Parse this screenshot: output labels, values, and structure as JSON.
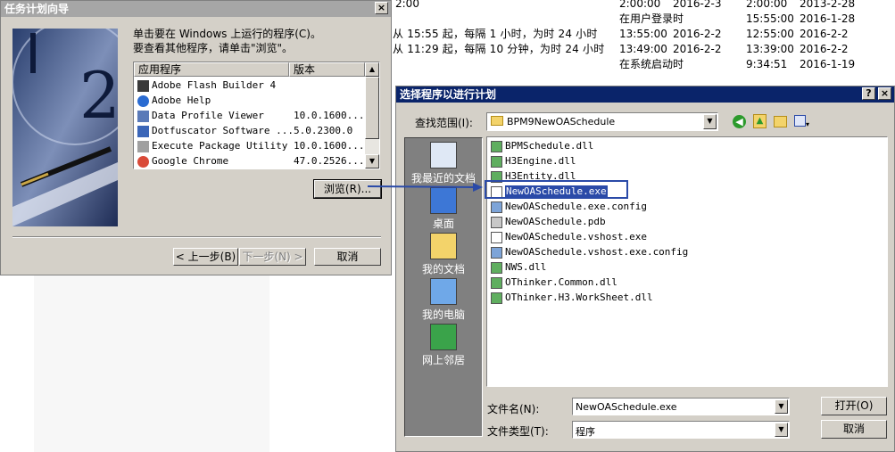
{
  "background_table": {
    "rows": [
      {
        "trigger": "2:00",
        "next_time": "2:00:00",
        "next_date": "2016-2-3",
        "last_time": "2:00:00",
        "last_date": "2013-2-28"
      },
      {
        "trigger": "",
        "next_time": "在用户登录时",
        "next_date": "",
        "last_time": "15:55:00",
        "last_date": "2016-1-28"
      },
      {
        "trigger": "从 15:55 起，每隔 1 小时，为时 24 小时",
        "next_time": "13:55:00",
        "next_date": "2016-2-2",
        "last_time": "12:55:00",
        "last_date": "2016-2-2"
      },
      {
        "trigger": "从 11:29 起，每隔 10 分钟，为时 24 小时",
        "next_time": "13:49:00",
        "next_date": "2016-2-2",
        "last_time": "13:39:00",
        "last_date": "2016-2-2"
      },
      {
        "trigger": "",
        "next_time": "在系统启动时",
        "next_date": "",
        "last_time": "9:34:51",
        "last_date": "2016-1-19"
      }
    ]
  },
  "wizard": {
    "title": "任务计划向导",
    "close": "×",
    "instruction_line1": "单击要在 Windows 上运行的程序(C)。",
    "instruction_line2": "要查看其他程序，请单击\"浏览\"。",
    "col_app": "应用程序",
    "col_version": "版本",
    "apps": [
      {
        "name": "Adobe Flash Builder 4",
        "version": "",
        "icon": "flash-builder-icon"
      },
      {
        "name": "Adobe Help",
        "version": "",
        "icon": "info-icon"
      },
      {
        "name": "Data Profile Viewer",
        "version": "10.0.1600...",
        "icon": "chart-icon"
      },
      {
        "name": "Dotfuscator Software ...",
        "version": "5.0.2300.0",
        "icon": "shield-icon"
      },
      {
        "name": "Execute Package Utility",
        "version": "10.0.1600...",
        "icon": "package-icon"
      },
      {
        "name": "Google Chrome",
        "version": "47.0.2526...",
        "icon": "chrome-icon"
      }
    ],
    "browse": "浏览(R)...",
    "back": "< 上一步(B)",
    "next": "下一步(N) >",
    "cancel": "取消"
  },
  "file_dialog": {
    "title": "选择程序以进行计划",
    "help": "?",
    "close": "×",
    "lookin_label": "查找范围(I):",
    "lookin_value": "BPM9NewOASchedule",
    "places": [
      {
        "label": "我最近的文档",
        "icon": "recent-documents-icon"
      },
      {
        "label": "桌面",
        "icon": "desktop-icon"
      },
      {
        "label": "我的文档",
        "icon": "my-documents-icon"
      },
      {
        "label": "我的电脑",
        "icon": "my-computer-icon"
      },
      {
        "label": "网上邻居",
        "icon": "network-icon"
      }
    ],
    "files": [
      {
        "name": "BPMSchedule.dll",
        "icon": "dll-icon"
      },
      {
        "name": "H3Engine.dll",
        "icon": "dll-icon"
      },
      {
        "name": "H3Entity.dll",
        "icon": "dll-icon"
      },
      {
        "name": "NewOASchedule.exe",
        "icon": "exe-icon"
      },
      {
        "name": "NewOASchedule.exe.config",
        "icon": "config-icon"
      },
      {
        "name": "NewOASchedule.pdb",
        "icon": "pdb-icon"
      },
      {
        "name": "NewOASchedule.vshost.exe",
        "icon": "exe-icon"
      },
      {
        "name": "NewOASchedule.vshost.exe.config",
        "icon": "config-icon"
      },
      {
        "name": "NWS.dll",
        "icon": "dll-icon"
      },
      {
        "name": "OThinker.Common.dll",
        "icon": "dll-icon"
      },
      {
        "name": "OThinker.H3.WorkSheet.dll",
        "icon": "dll-icon"
      }
    ],
    "filename_label": "文件名(N):",
    "filename_value": "NewOASchedule.exe",
    "filetype_label": "文件类型(T):",
    "filetype_value": "程序",
    "open": "打开(O)",
    "cancel": "取消"
  },
  "colors": {
    "highlight": "#2a4aa8",
    "titlebar_active": "#0a246a",
    "dialog_face": "#d4d0c8",
    "places_bar": "#808080"
  }
}
